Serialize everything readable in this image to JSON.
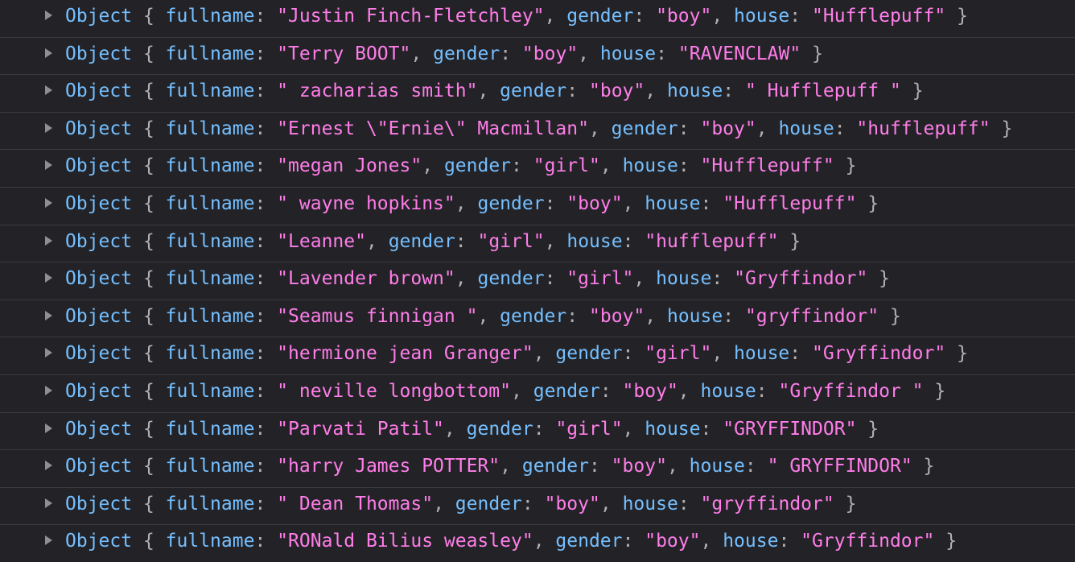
{
  "console": {
    "type_label": "Object",
    "open_brace": "{",
    "close_brace": "}",
    "colon": ":",
    "comma": ",",
    "quote": "\"",
    "keys": {
      "fullname": "fullname",
      "gender": "gender",
      "house": "house"
    },
    "rows": [
      {
        "fullname": "Justin Finch-Fletchley",
        "gender": "boy",
        "house": "Hufflepuff"
      },
      {
        "fullname": "Terry BOOT",
        "gender": "boy",
        "house": "RAVENCLAW"
      },
      {
        "fullname": " zacharias smith",
        "gender": "boy",
        "house": " Hufflepuff "
      },
      {
        "fullname": "Ernest \\\"Ernie\\\" Macmillan",
        "gender": "boy",
        "house": "hufflepuff"
      },
      {
        "fullname": "megan Jones",
        "gender": "girl",
        "house": "Hufflepuff"
      },
      {
        "fullname": " wayne hopkins",
        "gender": "boy",
        "house": "Hufflepuff"
      },
      {
        "fullname": "Leanne",
        "gender": "girl",
        "house": "hufflepuff"
      },
      {
        "fullname": "Lavender brown",
        "gender": "girl",
        "house": "Gryffindor"
      },
      {
        "fullname": "Seamus finnigan ",
        "gender": "boy",
        "house": "gryffindor"
      },
      {
        "fullname": "hermione jean Granger",
        "gender": "girl",
        "house": "Gryffindor"
      },
      {
        "fullname": " neville longbottom",
        "gender": "boy",
        "house": "Gryffindor "
      },
      {
        "fullname": "Parvati Patil",
        "gender": "girl",
        "house": "GRYFFINDOR"
      },
      {
        "fullname": "harry James POTTER",
        "gender": "boy",
        "house": " GRYFFINDOR"
      },
      {
        "fullname": " Dean Thomas",
        "gender": "boy",
        "house": "gryffindor"
      },
      {
        "fullname": "RONald Bilius weasley",
        "gender": "boy",
        "house": "Gryffindor"
      }
    ]
  },
  "colors": {
    "background": "#232327",
    "object_keyword": "#75bfff",
    "property_key": "#75bfff",
    "string_value": "#ff7de9",
    "punctuation": "#b1b1b3",
    "twisty": "#8e8e94",
    "row_separator": "#3b3b3f"
  },
  "icons": {
    "expand": "triangle-right-icon"
  }
}
